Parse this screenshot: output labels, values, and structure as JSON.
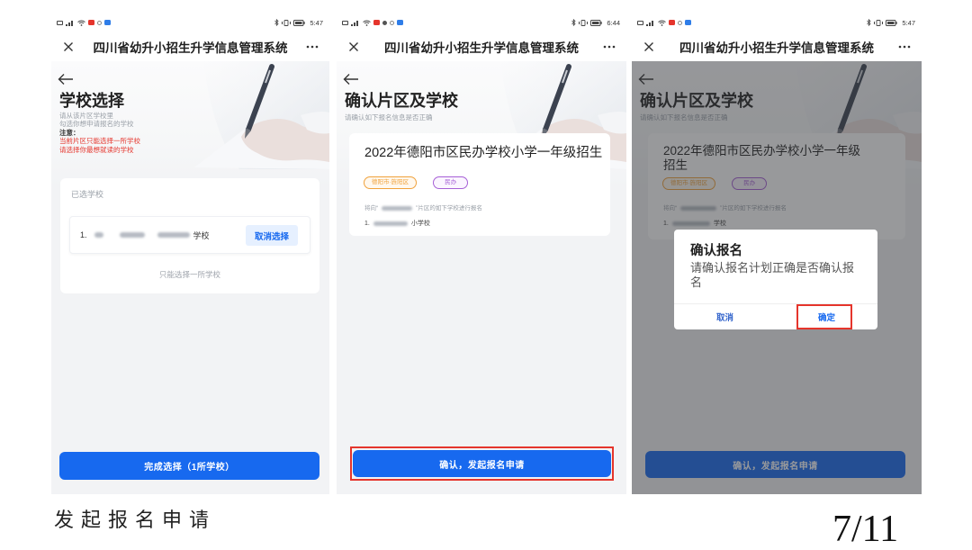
{
  "slide": {
    "caption": "发起报名申请",
    "page_number": "7/11"
  },
  "app": {
    "title": "四川省幼升小招生升学信息管理系统"
  },
  "colors": {
    "primary": "#1769ef",
    "danger": "#e5352c",
    "tag_region": "#f0a23c",
    "tag_type": "#a65fd6"
  },
  "icons": {
    "status_left": [
      "sim-card-icon",
      "signal-icon",
      "wifi-icon",
      "app-badge-icon",
      "notification-icon",
      "message-icon"
    ],
    "status_right": [
      "bluetooth-icon",
      "vibrate-icon",
      "battery-icon"
    ],
    "navigation": [
      "close-icon",
      "more-icon",
      "back-arrow-icon"
    ],
    "illustration": "hand-writing-illustration"
  },
  "screen1": {
    "status_time": "5:47",
    "heading": "学校选择",
    "hint_lines": [
      "请从该片区学校里",
      "勾选你想申请报名的学校"
    ],
    "notice_label": "注意：",
    "notice_lines": [
      "当前片区只能选择一所学校",
      "请选择你最想就读的学校"
    ],
    "selected_label": "已选学校",
    "item_index": "1.",
    "item_suffix": "学校",
    "deselect_button": "取消选择",
    "limit_note": "只能选择一所学校",
    "primary_button": "完成选择（1所学校）"
  },
  "screen2": {
    "status_time": "6:44",
    "heading": "确认片区及学校",
    "subtitle": "请确认如下报名信息是否正确",
    "plan_title": "2022年德阳市区民办学校小学一年级招生",
    "tags": [
      "德阳市·旌阳区",
      "民办"
    ],
    "target_prefix": "将向“",
    "target_suffix": "”片区的如下学校进行报名",
    "item_index": "1.",
    "item_suffix": "小学校",
    "primary_button": "确认，发起报名申请",
    "submit_highlighted": true
  },
  "screen3": {
    "status_time": "5:47",
    "heading": "确认片区及学校",
    "subtitle": "请确认如下报名信息是否正确",
    "plan_title_lines": [
      "2022年德阳市区民办学校小学一年级",
      "招生"
    ],
    "tags": [
      "德阳市·旌阳区",
      "民办"
    ],
    "target_prefix": "将向“",
    "target_suffix": "”片区的如下学校进行报名",
    "item_index": "1.",
    "item_suffix": "学校",
    "primary_button": "确认，发起报名申请",
    "dialog": {
      "title": "确认报名",
      "message": "请确认报名计划正确是否确认报名",
      "cancel": "取消",
      "confirm": "确定",
      "confirm_highlighted": true
    }
  }
}
